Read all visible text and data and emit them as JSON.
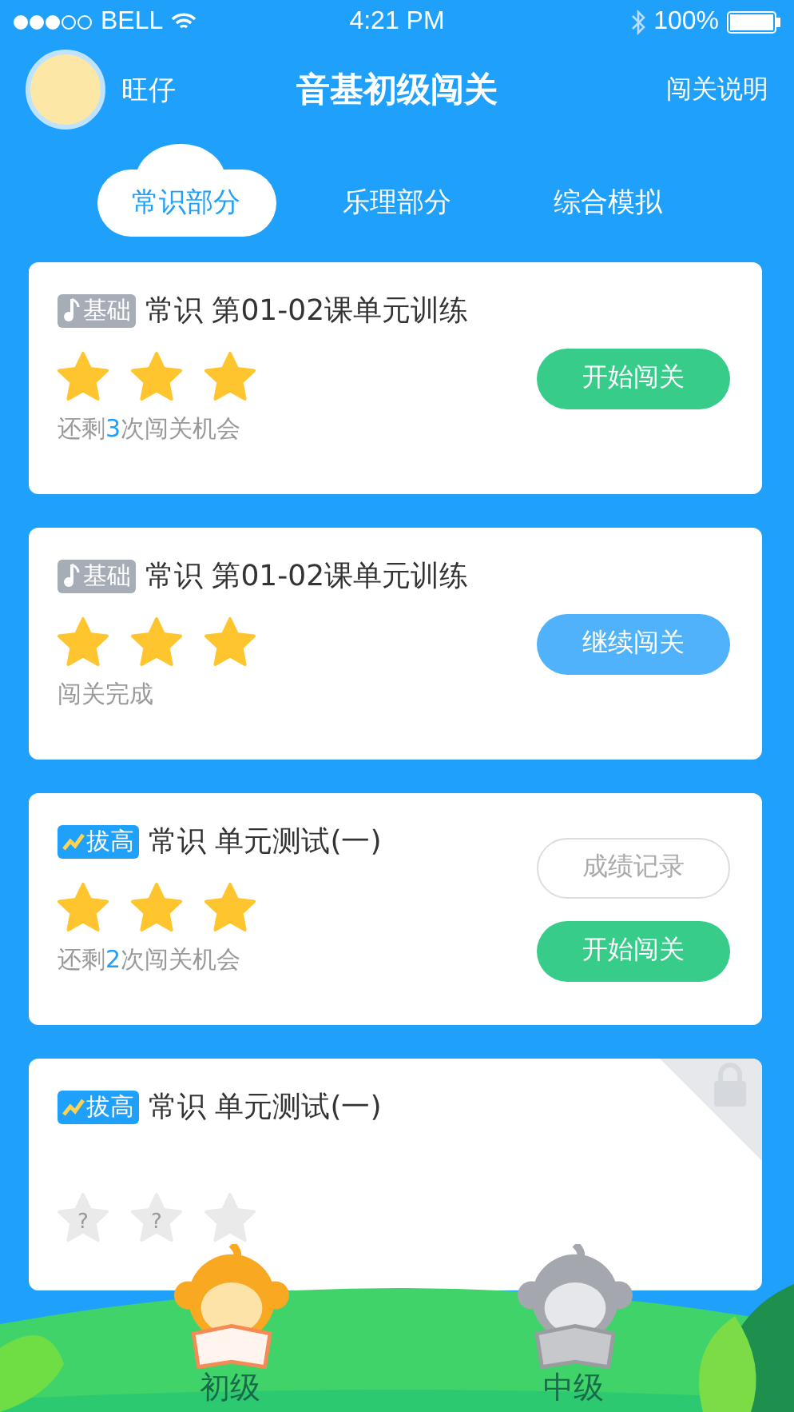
{
  "status_bar": {
    "carrier": "BELL",
    "time": "4:21 PM",
    "battery": "100%"
  },
  "header": {
    "user_name": "旺仔",
    "title": "音基初级闯关",
    "help_link": "闯关说明"
  },
  "tabs": [
    {
      "label": "常识部分",
      "selected": true
    },
    {
      "label": "乐理部分",
      "selected": false
    },
    {
      "label": "综合模拟",
      "selected": false
    }
  ],
  "cards": [
    {
      "tag": {
        "kind": "basic",
        "label": "基础"
      },
      "title": "常识 第01-02课单元训练",
      "locked": false,
      "stars": 3,
      "note": {
        "kind": "remaining",
        "prefix": "还剩",
        "count": "3",
        "suffix": "次闯关机会"
      },
      "buttons": [
        {
          "kind": "start",
          "label": "开始闯关"
        }
      ]
    },
    {
      "tag": {
        "kind": "basic",
        "label": "基础"
      },
      "title": "常识 第01-02课单元训练",
      "locked": false,
      "stars": 3,
      "note": {
        "kind": "done",
        "text": "闯关完成"
      },
      "buttons": [
        {
          "kind": "continue",
          "label": "继续闯关"
        }
      ]
    },
    {
      "tag": {
        "kind": "advanced",
        "label": "拔高"
      },
      "title": "常识 单元测试(一)",
      "locked": false,
      "stars": 3,
      "note": {
        "kind": "remaining",
        "prefix": "还剩",
        "count": "2",
        "suffix": "次闯关机会"
      },
      "buttons": [
        {
          "kind": "record",
          "label": "成绩记录"
        },
        {
          "kind": "start",
          "label": "开始闯关"
        }
      ]
    },
    {
      "tag": {
        "kind": "advanced",
        "label": "拔高"
      },
      "title": "常识 单元测试(一)",
      "locked": true,
      "star_marks": [
        "?",
        "?"
      ]
    }
  ],
  "levels": [
    {
      "label": "初级",
      "kind": "orange"
    },
    {
      "label": "中级",
      "kind": "gray"
    }
  ]
}
